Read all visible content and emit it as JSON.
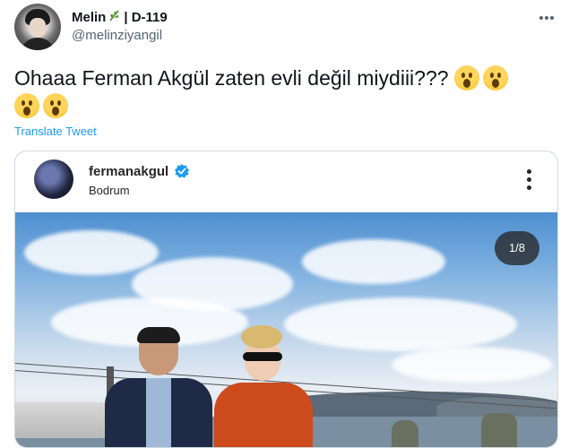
{
  "tweet": {
    "display_name": "Melin",
    "name_suffix": "| D-119",
    "handle": "@melinziyangil",
    "text": "Ohaaa Ferman Akgül zaten evli değil miydiii???",
    "translate_label": "Translate Tweet"
  },
  "embed": {
    "username": "fermanakgul",
    "location": "Bodrum",
    "media_counter": "1/8"
  },
  "colors": {
    "link_blue": "#1d9bf0",
    "verified_blue": "#1d9bf0",
    "text_primary": "#0f1419",
    "text_secondary": "#536471"
  },
  "icons": {
    "name_badge": "leaf-icon",
    "more": "more-horizontal-icon",
    "embed_more": "more-vertical-icon",
    "verified": "verified-badge-icon",
    "emoji": "astonished-face-emoji"
  }
}
